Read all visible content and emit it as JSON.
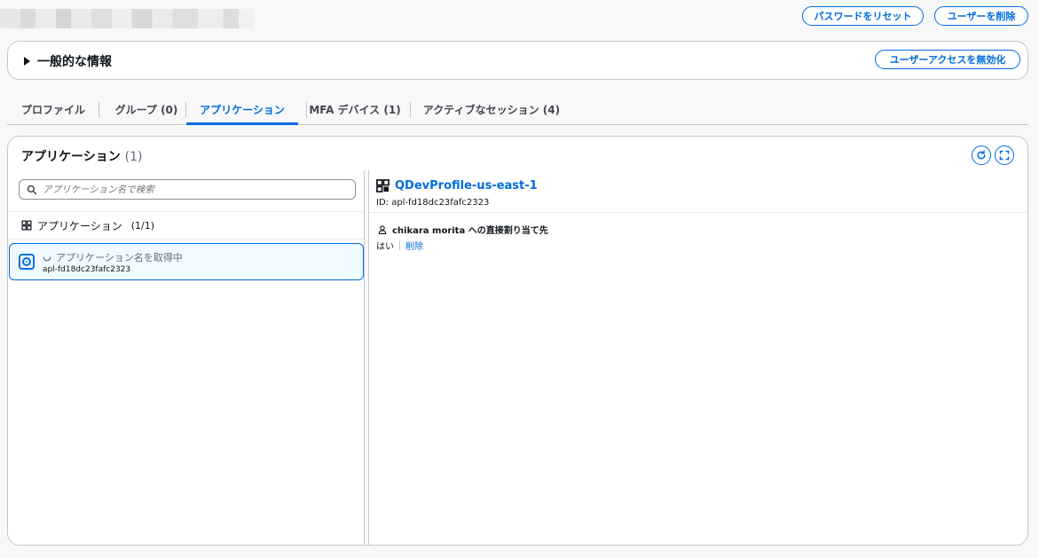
{
  "header": {
    "reset_password_label": "パスワードをリセット",
    "delete_user_label": "ユーザーを削除"
  },
  "general": {
    "title": "一般的な情報",
    "disable_access_label": "ユーザーアクセスを無効化"
  },
  "tabs": [
    {
      "label": "プロファイル"
    },
    {
      "label": "グループ (0)"
    },
    {
      "label": "アプリケーション"
    },
    {
      "label": "MFA デバイス (1)"
    },
    {
      "label": "アクティブなセッション (4)"
    }
  ],
  "applications": {
    "title": "アプリケーション",
    "count": "(1)",
    "search_placeholder": "アプリケーション名で検索",
    "list_header": "アプリケーション",
    "list_count": "(1/1)",
    "items": [
      {
        "loading_text": "アプリケーション名を取得中",
        "id": "apl-fd18dc23fafc2323"
      }
    ]
  },
  "detail": {
    "name": "QDevProfile-us-east-1",
    "id_text": "ID: apl-fd18dc23fafc2323",
    "assignment_label": "chikara morita への直接割り当て先",
    "assignment_value": "はい",
    "remove_label": "削除"
  },
  "colors": {
    "accent": "#006ce0",
    "border": "#c6c6cd",
    "background": "#f8f8f8"
  }
}
